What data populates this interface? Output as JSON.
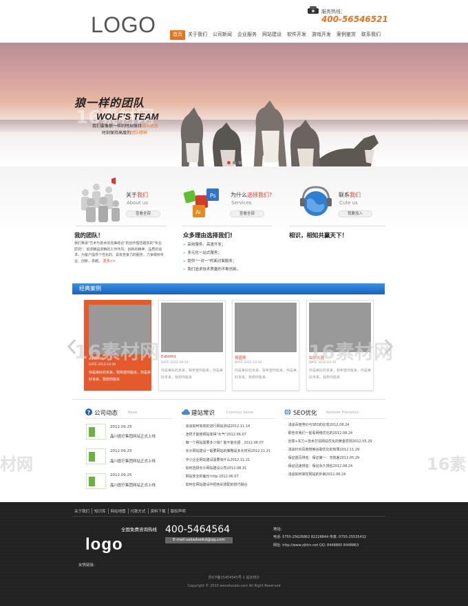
{
  "header": {
    "logo": "LOGO",
    "hotline_label": "服务热线：",
    "hotline_number": "400-56546521",
    "nav": [
      "首页",
      "关于我们",
      "公司新闻",
      "企业服务",
      "网站建设",
      "软件开发",
      "游戏开发",
      "案例鉴赏",
      "联系我们"
    ]
  },
  "banner": {
    "slogan_cn": "狼一样的团队",
    "slogan_en": "WOLF'S TEAM",
    "line1_a": "我们要像狼一样的时刻保持",
    "line1_b": "战斗状态",
    "line2_a": "时刻保持高度的",
    "line2_b": "团队精神"
  },
  "services": {
    "about": {
      "title_a": "关于",
      "title_b": "我们",
      "sub": "About us",
      "btn": "查看全部"
    },
    "why": {
      "title_a": "为什么",
      "title_b": "选择我们?",
      "sub": "Services",
      "btn": "查看全部"
    },
    "contact": {
      "title_a": "联系",
      "title_b": "我们",
      "sub": "Cute us",
      "btn": "我要加入"
    }
  },
  "sections": {
    "team_head": "我的团队！",
    "team_text": "我们秉承\"艺术与技术的完美结合\"的创作理念踏实的\"专业原则\"：追求精益求精的工作作风、创新的精神、品质的追求，为客户提供个性化的、具有竞争力的服务，力争做到专业、创新、卓越。",
    "team_more": "更多>>",
    "reasons_head": "众多理由选择我们!",
    "reasons": [
      "高效服务，高速开发；",
      "多元化一站式服务；",
      "提供\"一对一\"的面对面服务；",
      "我们追求技术质量的不断创新。"
    ],
    "win_head": "相识，相知共赢天下！"
  },
  "cases": {
    "title": "经典案例",
    "items": [
      {
        "title": "dsfd4fd",
        "date": "DATE 2012-10-10",
        "desc": "你是美好的未来，我希望你能来，你是美好未来，我想你能来"
      },
      {
        "title": "Edfd4fd",
        "date": "DATE 2012-10-10",
        "desc": "你是美好的未来，我希望你能来，你是美好未来，我想你能来"
      },
      {
        "title": "哥蓝斯",
        "date": "DATE 2012-10-10",
        "desc": "你是美好的未来，我希望你能来，你是美好未来，我想你能来"
      },
      {
        "title": "如梦天涯",
        "date": "DATE 2012-10-10",
        "desc": "你是美好的未来，我希望你能来，你是美好未来，我想你能来"
      }
    ]
  },
  "news": {
    "company": {
      "title": "公司动态",
      "en": "News",
      "items": [
        {
          "date": "2012.09.25",
          "title": "晶川医疗集团网站正式上线"
        },
        {
          "date": "2012.09.25",
          "title": "晶川医疗集团网站正式上线"
        },
        {
          "date": "2012.09.25",
          "title": "晶川医疗集团网站正式上线"
        }
      ],
      "thumb_label": "晶川医疗"
    },
    "common": {
      "title": "建站常识",
      "en": "Common Sense",
      "items": [
        "谈谈如何有效的进行网站测试2012.11.14",
        "怎样才能使网站变得\"大气\"2012.06.07",
        "做一个网站需要多少钱？能不能先报 . 2012.06.07",
        "长沙网站建设一般要网站的策略是多长时间2012.11.21",
        "中小企业网站建设需要有什么2012.11.21",
        "如何选择长沙网站建设公司2012.08.31",
        "网站安全的备份 http 2012.06.07",
        "如何在网站建设中把色彩搭配的技巧融合"
      ]
    },
    "seo": {
      "title": "SEO优化",
      "en": "Network Promotion",
      "items": [
        "浅谈百度竞价与SEO的比较2012.08.24",
        "那些年我们一起看网络优化的2012.08.24",
        "创意+实力+技术打造网站优化的黄金原则2012.05.29",
        "浅谈针对百度搜索谷歌优化的效果2012.11.29",
        "保证首页排名：保证第一：无效差2012.05.29",
        "保证迅速排名：保证永久排名2012.08.24",
        "浅谈如何掌控网站的外链2012.08.24"
      ]
    }
  },
  "footer": {
    "links": [
      "关于我们",
      "知识库",
      "网站地图",
      "付款方式",
      "资料下载",
      "版权声明"
    ],
    "logo": "logo",
    "consult_label": "全国免费咨询热线",
    "consult_number": "400-5464564",
    "email": "E-mail:sakadsaikd@qq.com",
    "addr_label": "地址:",
    "addr_phone": "电话: 0755-25626862 82228844  传真: 0755-25535432",
    "addr_web": "网址: http://www.zjhhn.net  QQ: 8448860 8448863",
    "friend_label": "友情链接:",
    "icp": "苏ICP备15454545号-1 站长统计",
    "copyright": "Copyright © 2010 wanzhoubo.com All Right Reserved"
  }
}
